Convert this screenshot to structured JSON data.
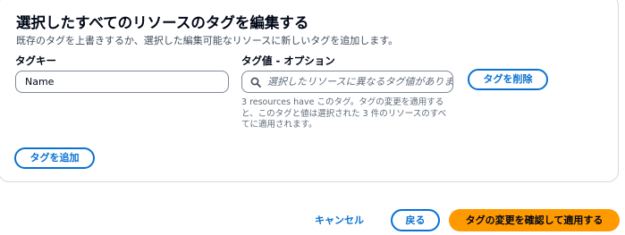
{
  "panel": {
    "title": "選択したすべてのリソースのタグを編集する",
    "description": "既存のタグを上書きするか、選択した編集可能なリソースに新しいタグを追加します。"
  },
  "tag_row": {
    "key_label": "タグキー",
    "key_value": "Name",
    "value_label": "タグ値 - オプション",
    "value_placeholder": "選択したリソースに異なるタグ値があります",
    "search_icon": "search-icon",
    "remove_label": "タグを削除",
    "hint_lines": [
      "3 resources have このタグ。タグの変更を適用する",
      "と、このタグと値は選択された 3 件のリソースのすべ",
      "てに適用されます。"
    ]
  },
  "add_tag_label": "タグを追加",
  "footer": {
    "cancel_label": "キャンセル",
    "back_label": "戻る",
    "apply_label": "タグの変更を確認して適用する"
  },
  "colors": {
    "accent": "#0972d3",
    "primary_button": "#ff9900",
    "border": "#7d8998"
  }
}
